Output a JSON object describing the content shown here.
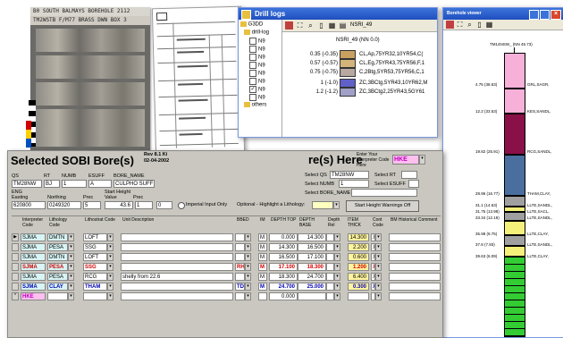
{
  "core_photo": {
    "label": "B0 SOUTH  BALMAYS  BOREHOLE  2112",
    "label2": "TM2WSTB  F/M77 BRASS DWN BOX 3"
  },
  "drill_logs": {
    "title": "Drill logs",
    "tree_root": "G3DD",
    "tree_group": "drill-log",
    "tree_items": [
      "N9",
      "N9",
      "N9",
      "N9",
      "N9",
      "N9",
      "N9",
      "N9"
    ],
    "tree_others": "others",
    "toolbar_label": "NSRI_49",
    "log_title": "NSRI_49  (NN 0.0)",
    "rows": [
      {
        "depth": "0.35 (-0.35)",
        "desc": "CL,Ap,75YR32,10YR54,C(",
        "color": "#c8a060"
      },
      {
        "depth": "0.57 (-0.57)",
        "desc": "CL,Eg,75YR43,75YR56,F,1",
        "color": "#d4b47a"
      },
      {
        "depth": "0.75 (-0.75)",
        "desc": "C,2Btg,5YR53,75YR56,C,1",
        "color": "#b8a8a0"
      },
      {
        "depth": "1 (-1.0)",
        "desc": "ZC,3BCtg,5YR43,10YR62,M",
        "color": "#6060c8"
      },
      {
        "depth": "1.2 (-1.2)",
        "desc": "ZC,3BCtg2,25YR43,5GY61",
        "color": "#a0a0c8"
      }
    ]
  },
  "borehole_viewer": {
    "title": "Borehole viewer",
    "header": "TM14NSW_ (NN 45.73)",
    "segments": [
      {
        "depth": "4.75 (38.63)",
        "lith": "GRL,SAGR,",
        "color": "#f7b0d8"
      },
      {
        "depth": "12.2 (33.53)",
        "lith": "KES,SANDL,",
        "color": "#f7b0d8"
      },
      {
        "depth": "19.82 (25.91)",
        "lith": "RCG,SANDL,",
        "color": "#8a1048"
      },
      {
        "depth": "28.96 (16.77)",
        "lith": "THAM,CLAY,",
        "color": "#4a6f9f"
      },
      {
        "depth": "31.1 (14.63)",
        "lith": "LLTE,SANDL,",
        "color": "#a0a0a0"
      },
      {
        "depth": "31.75 (13.98)",
        "lith": "LLTE,SACL,",
        "color": "#f5f07a"
      },
      {
        "depth": "33.34 (12.18)",
        "lith": "LLTE,SANDL,",
        "color": "#a0a0a0"
      },
      {
        "depth": "35.98 (9.75)",
        "lith": "LLTE,CLAY,",
        "color": "#f5f07a"
      },
      {
        "depth": "37.8 (7.93)",
        "lith": "LLTE,SANDL,",
        "color": "#a0a0a0"
      },
      {
        "depth": "39.63 (6.09)",
        "lith": "LLTE,CLAY,",
        "color": "#f5f07a"
      },
      {
        "depth": "",
        "lith": "",
        "color": "#33cc33"
      }
    ]
  },
  "sobi": {
    "title": "Selected SOBI Bore(s)",
    "rev": "Rev 8.1 Ki",
    "rev_date": "02-04-2002",
    "title_right": "re(s) Here",
    "enter_prompt": "Enter Your Interpreter Code Here",
    "interpreter_code": "HKE",
    "fields": {
      "qs_label": "QS",
      "qs_value": "TM28NW",
      "rt_label": "RT",
      "rt_value": "BJ",
      "numb_label": "NUMB",
      "numb_value": "1",
      "esuff_label": "ESUFF",
      "esuff_value": "A",
      "name_label": "BORE_NAME",
      "name_value": "CULPHO SUFF",
      "eng_label": "ENG",
      "easting_label": "Easting",
      "easting_value": "620800",
      "northing_label": "Northing",
      "northing_value": "0249320",
      "prec_label": "Prec",
      "prec_value": "5",
      "sh_label": "Start Height",
      "value_label": "Value",
      "sh_value": "43.6",
      "prec2_label": "Prec",
      "prec2_value": "1",
      "extra_value": "0",
      "imperial_label": "Imperial Input Only",
      "optional_label": "Optional - Highlight a Lithology:",
      "warnings_button": "Start Height Warnings Off",
      "select_qs_label": "Select QS",
      "select_qs_value": "TM28NW",
      "select_rt_label": "Select RT",
      "select_numb_label": "Select NUMB",
      "select_numb_value": "1",
      "select_esuff_label": "Select ESUFF",
      "select_name_label": "Select BORE_NAME"
    },
    "columns": [
      "Interpreter Code",
      "Lithology Code",
      "Lithostrat Code",
      "Unit Description",
      "BBED",
      "IM",
      "DEPTH TOP",
      "DEPTH BASE",
      "Depth Rel",
      "ITEM THICK",
      "Cont Code",
      "BM Historical Comment"
    ],
    "rows": [
      {
        "interp": "SJMA",
        "lith": "DMTN",
        "strat": "LOFT",
        "desc": "",
        "bbed": "",
        "im": "M",
        "top": "0.000",
        "base": "14.300",
        "rel": "",
        "thick": "14.300",
        "cont": "X",
        "style": "normal"
      },
      {
        "interp": "SJMA",
        "lith": "PESA",
        "strat": "SSG",
        "desc": "",
        "bbed": "",
        "im": "M",
        "top": "14.300",
        "base": "16.500",
        "rel": "",
        "thick": "2.200",
        "cont": "X",
        "style": "normal"
      },
      {
        "interp": "SJMA",
        "lith": "DMTN",
        "strat": "LOFT",
        "desc": "",
        "bbed": "",
        "im": "M",
        "top": "16.500",
        "base": "17.100",
        "rel": "",
        "thick": "0.600",
        "cont": "X",
        "style": "normal"
      },
      {
        "interp": "SJMA",
        "lith": "PESA",
        "strat": "SSG",
        "desc": "",
        "bbed": "RH",
        "im": "M",
        "top": "17.100",
        "base": "18.300",
        "rel": "",
        "thick": "1.200",
        "cont": "X",
        "style": "red"
      },
      {
        "interp": "SJMA",
        "lith": "PESA",
        "strat": "RCG",
        "desc": "shelly from 22.6",
        "bbed": "",
        "im": "M",
        "top": "18.300",
        "base": "24.700",
        "rel": "",
        "thick": "6.400",
        "cont": "X",
        "style": "normal"
      },
      {
        "interp": "SJMA",
        "lith": "CLAY",
        "strat": "THAM",
        "desc": "",
        "bbed": "TD",
        "im": "M",
        "top": "24.700",
        "base": "25.000",
        "rel": "",
        "thick": "0.300",
        "cont": "X",
        "style": "blue"
      },
      {
        "interp": "HKE",
        "lith": "",
        "strat": "",
        "desc": "",
        "bbed": "",
        "im": "",
        "top": "0.000",
        "base": "",
        "rel": "",
        "thick": "",
        "cont": "",
        "style": "new"
      }
    ]
  }
}
